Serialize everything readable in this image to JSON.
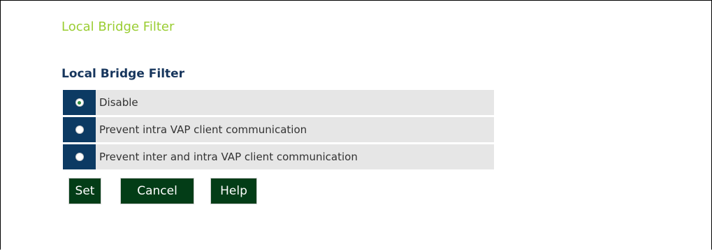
{
  "page": {
    "title": "Local Bridge Filter",
    "section_title": "Local Bridge Filter"
  },
  "options": [
    {
      "label": "Disable",
      "selected": true
    },
    {
      "label": "Prevent intra VAP client communication",
      "selected": false
    },
    {
      "label": "Prevent inter and intra VAP client communication",
      "selected": false
    }
  ],
  "buttons": {
    "set_label": "Set",
    "cancel_label": "Cancel",
    "help_label": "Help"
  },
  "colors": {
    "title": "#9acd32",
    "section_title": "#17365d",
    "radio_cell": "#0c3a63",
    "row_background": "#e6e6e6",
    "button_background": "#033d17",
    "button_text": "#ffffff"
  }
}
